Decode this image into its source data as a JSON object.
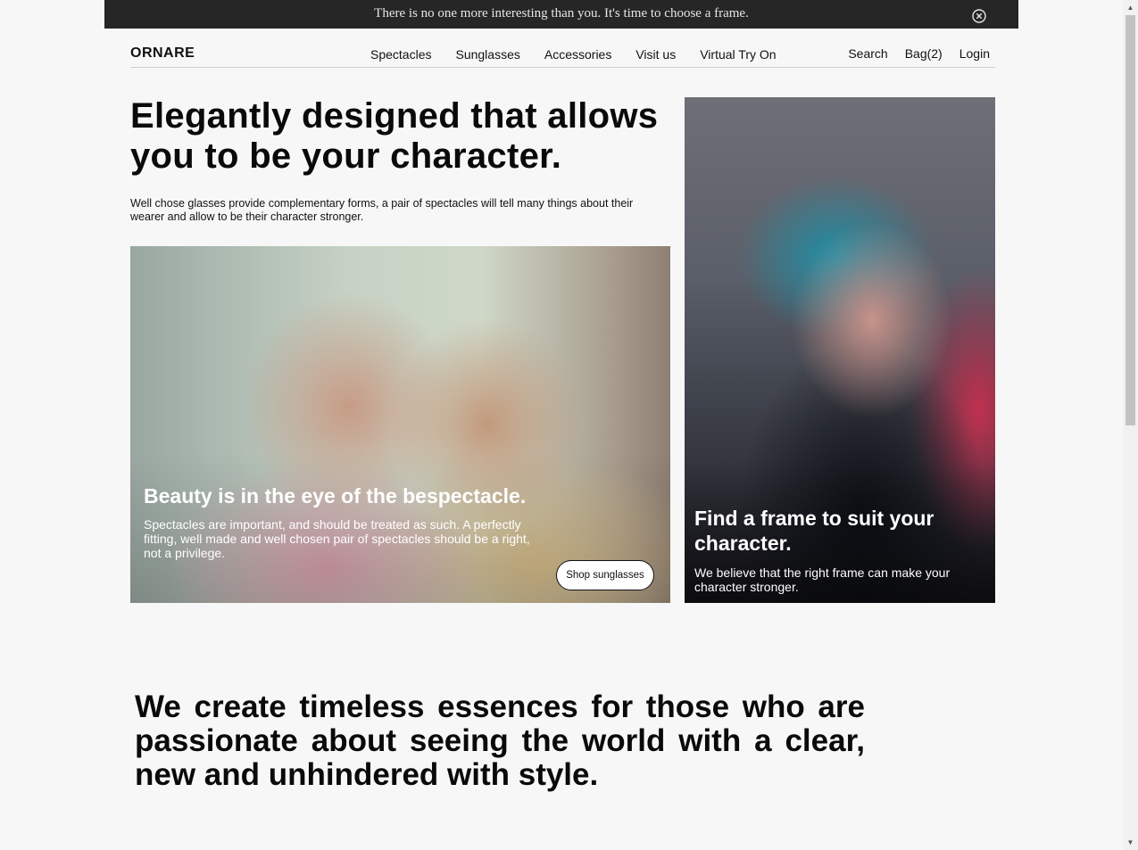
{
  "announcement": {
    "text": "There is no one more interesting than you. It's time to choose a frame.",
    "close_icon": "close-circle-icon"
  },
  "header": {
    "logo": "ORNARE",
    "nav": [
      "Spectacles",
      "Sunglasses",
      "Accessories",
      "Visit us",
      "Virtual Try On"
    ],
    "search": "Search",
    "bag": "Bag(2)",
    "login": "Login"
  },
  "hero": {
    "title": "Elegantly designed that allows you to be your character.",
    "description": "Well chose glasses provide complementary forms, a pair of spectacles will tell many things about their wearer and allow to be their character stronger."
  },
  "card_left": {
    "title": "Beauty is in the eye of the bespectacle.",
    "text": "Spectacles are important, and should be treated as such. A perfectly fitting, well made and well chosen pair of spectacles should be a right, not a privilege.",
    "button": "Shop sunglasses"
  },
  "card_right": {
    "title": "Find a frame to suit your character.",
    "text": "We believe that the right frame can make your character stronger."
  },
  "statement": "We create timeless essences for those who are passionate about seeing the world with a clear, new and unhindered with style."
}
